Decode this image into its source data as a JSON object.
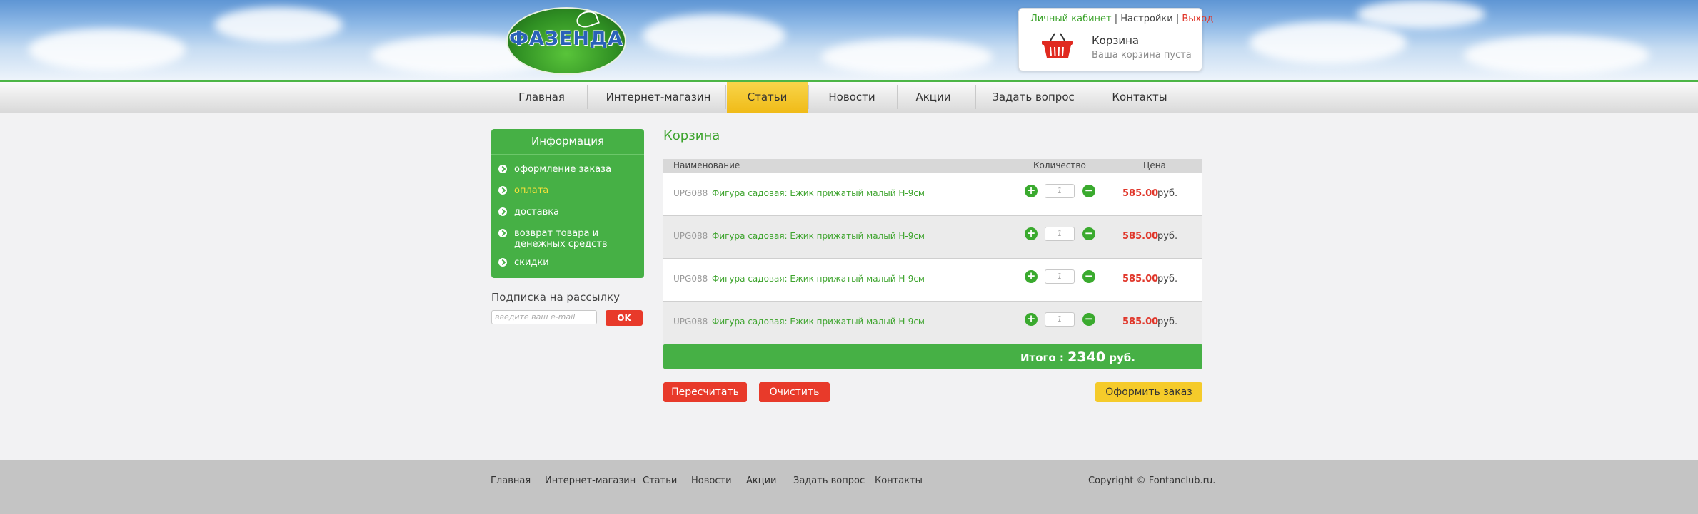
{
  "header": {
    "logo_text": "ФАЗЕНДА",
    "account_link": "Личный кабинет",
    "sep1": "|",
    "settings_link": "Настройки",
    "sep2": "|",
    "logout_link": "Выход",
    "cart_title": "Корзина",
    "cart_status": "Ваша корзина пуста"
  },
  "nav": {
    "items": [
      {
        "label": "Главная"
      },
      {
        "label": "Интернет-магазин"
      },
      {
        "label": "Статьи"
      },
      {
        "label": "Новости"
      },
      {
        "label": "Акции"
      },
      {
        "label": "Задать вопрос"
      },
      {
        "label": "Контакты"
      }
    ],
    "active": "Статьи"
  },
  "sidebar": {
    "title": "Информация",
    "items": [
      {
        "label": "оформление заказа"
      },
      {
        "label": "оплата"
      },
      {
        "label": "доставка"
      },
      {
        "label": "возврат товара и денежных средств"
      },
      {
        "label": "скидки"
      }
    ],
    "active": "оплата",
    "subscribe_title": "Подписка на рассылку",
    "email_placeholder": "введите ваш e-mail",
    "ok_label": "OK"
  },
  "cart": {
    "title": "Корзина",
    "columns": {
      "name": "Наименование",
      "qty": "Количество",
      "price": "Цена"
    },
    "rows": [
      {
        "code": "UPG088",
        "name": "Фигура садовая: Ежик прижатый малый H-9см",
        "qty": "1",
        "price": "585.00",
        "currency": "руб."
      },
      {
        "code": "UPG088",
        "name": "Фигура садовая: Ежик прижатый малый H-9см",
        "qty": "1",
        "price": "585.00",
        "currency": "руб."
      },
      {
        "code": "UPG088",
        "name": "Фигура садовая: Ежик прижатый малый H-9см",
        "qty": "1",
        "price": "585.00",
        "currency": "руб."
      },
      {
        "code": "UPG088",
        "name": "Фигура садовая: Ежик прижатый малый H-9см",
        "qty": "1",
        "price": "585.00",
        "currency": "руб."
      }
    ],
    "total_label": "Итого :",
    "total_value": "2340",
    "total_currency": "руб.",
    "recalc_label": "Пересчитать",
    "clear_label": "Очистить",
    "checkout_label": "Оформить заказ"
  },
  "footer": {
    "links": [
      {
        "label": "Главная"
      },
      {
        "label": "Интернет-магазин"
      },
      {
        "label": "Статьи"
      },
      {
        "label": "Новости"
      },
      {
        "label": "Акции"
      },
      {
        "label": "Задать вопрос"
      },
      {
        "label": "Контакты"
      }
    ],
    "copyright": "Copyright © Fontanclub.ru."
  },
  "colors": {
    "brand_green": "#46b045",
    "accent_red": "#e83a2a",
    "accent_yellow": "#f5cb2a"
  }
}
